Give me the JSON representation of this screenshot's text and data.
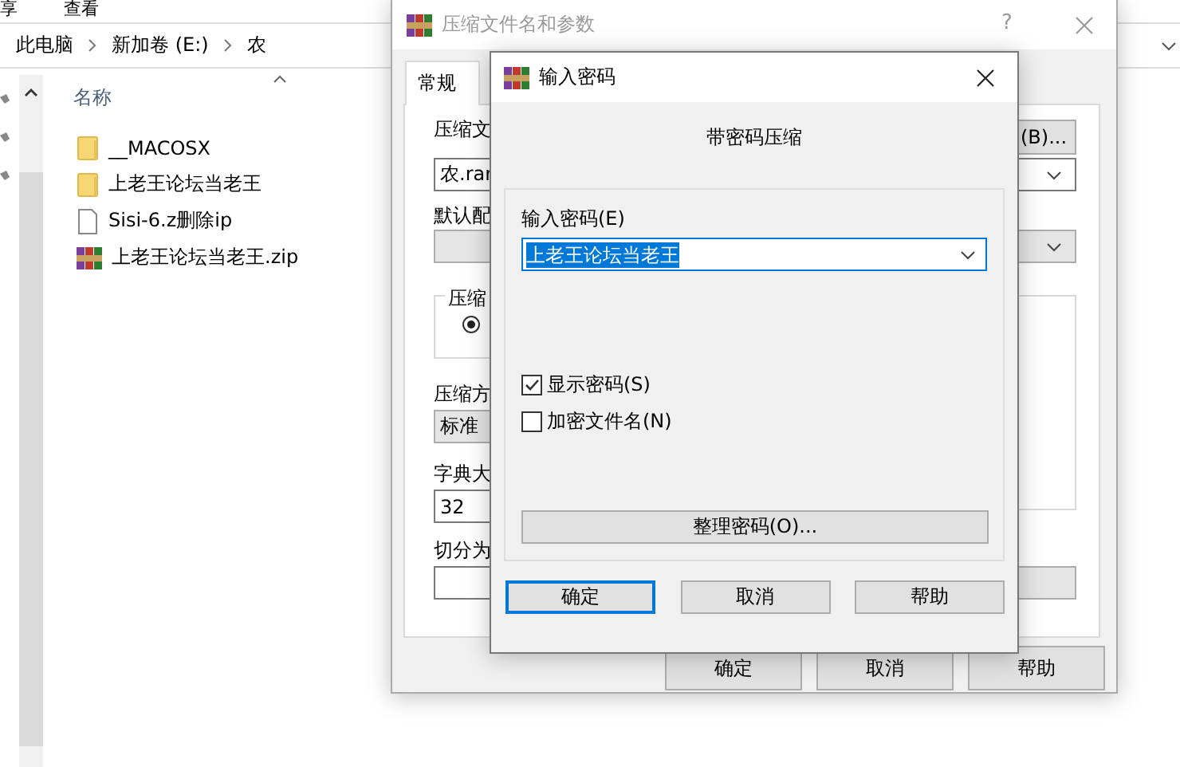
{
  "explorer": {
    "menu": [
      "享",
      "查看"
    ],
    "breadcrumb": [
      "此电脑",
      "新加卷 (E:)",
      "农"
    ],
    "column_header": "名称",
    "files": [
      {
        "name": "__MACOSX",
        "kind": "folder"
      },
      {
        "name": "上老王论坛当老王",
        "kind": "folder"
      },
      {
        "name": "Sisi-6.z删除ip",
        "kind": "file"
      },
      {
        "name": "上老王论坛当老王.zip",
        "kind": "archive"
      }
    ]
  },
  "archive_dialog": {
    "title": "压缩文件名和参数",
    "help": "?",
    "tabs": [
      {
        "label": "常规",
        "selected": true
      }
    ],
    "archive_name_label": "压缩文",
    "browse_button": "(B)...",
    "archive_name": "农.rar",
    "profile_label": "默认配",
    "format_group": {
      "legend": "压缩",
      "radio_checked": true
    },
    "method_label": "压缩方",
    "method": "标准",
    "dictionary_label": "字典大",
    "dictionary": "32",
    "split_label": "切分为",
    "buttons": [
      "确定",
      "取消",
      "帮助"
    ]
  },
  "password_dialog": {
    "title": "输入密码",
    "heading": "带密码压缩",
    "password_label": "输入密码(E)",
    "password": "上老王论坛当老王",
    "checkboxes": [
      {
        "label": "显示密码(S)",
        "checked": true
      },
      {
        "label": "加密文件名(N)",
        "checked": false
      }
    ],
    "organize_button": "整理密码(O)...",
    "buttons": [
      {
        "label": "确定",
        "default": true
      },
      {
        "label": "取消",
        "default": false
      },
      {
        "label": "帮助",
        "default": false
      }
    ]
  }
}
